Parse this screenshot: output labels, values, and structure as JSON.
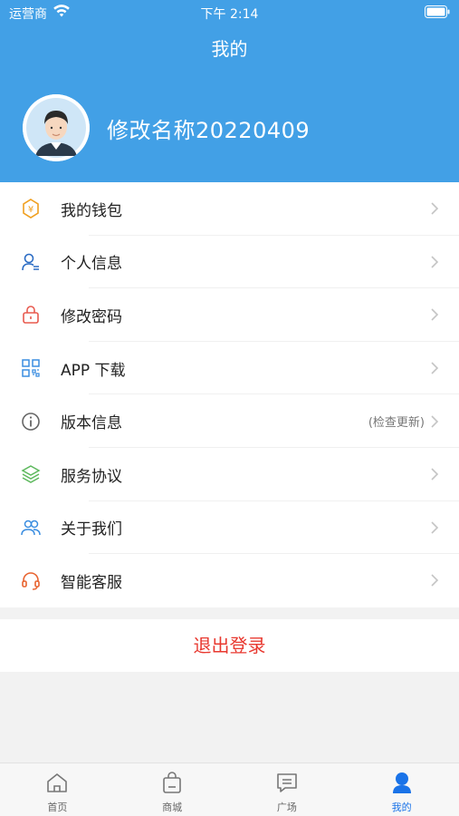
{
  "status_bar": {
    "carrier": "运营商",
    "time": "下午 2:14"
  },
  "header": {
    "title": "我的",
    "background_color": "#42a0e6"
  },
  "profile": {
    "name": "修改名称20220409",
    "avatar_icon": "avatar-icon"
  },
  "menu": {
    "items": [
      {
        "label": "我的钱包",
        "icon": "wallet-icon",
        "extra": ""
      },
      {
        "label": "个人信息",
        "icon": "user-info-icon",
        "extra": ""
      },
      {
        "label": "修改密码",
        "icon": "lock-icon",
        "extra": ""
      },
      {
        "label": "APP 下载",
        "icon": "qr-code-icon",
        "extra": ""
      },
      {
        "label": "版本信息",
        "icon": "info-icon",
        "extra": "(检查更新)"
      },
      {
        "label": "服务协议",
        "icon": "layers-icon",
        "extra": ""
      },
      {
        "label": "关于我们",
        "icon": "people-icon",
        "extra": ""
      },
      {
        "label": "智能客服",
        "icon": "headset-icon",
        "extra": ""
      }
    ]
  },
  "logout": {
    "label": "退出登录",
    "color": "#e8382f"
  },
  "tabbar": {
    "tabs": [
      {
        "label": "首页",
        "icon": "home-icon",
        "active": false
      },
      {
        "label": "商城",
        "icon": "shopping-bag-icon",
        "active": false
      },
      {
        "label": "广场",
        "icon": "message-icon",
        "active": false
      },
      {
        "label": "我的",
        "icon": "person-icon",
        "active": true
      }
    ],
    "active_color": "#1a73e8"
  }
}
